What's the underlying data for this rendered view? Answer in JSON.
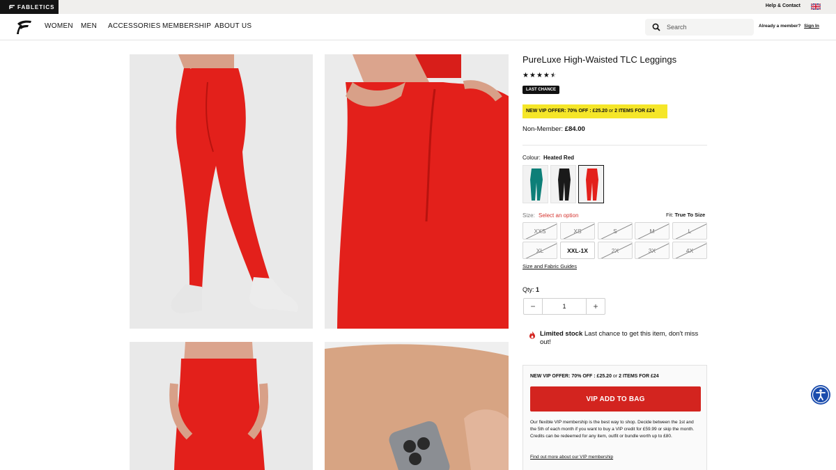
{
  "topbar": {
    "brand": "FABLETICS",
    "help": "Help & Contact"
  },
  "nav": {
    "items": [
      "WOMEN",
      "MEN",
      "ACCESSORIES",
      "MEMBERSHIP",
      "ABOUT US"
    ],
    "search_placeholder": "Search",
    "member_prompt": "Already a member?",
    "sign_in": "Sign In"
  },
  "product": {
    "title": "PureLuxe High-Waisted TLC Leggings",
    "rating": 4.5,
    "badge": "LAST CHANCE",
    "vip_offer": {
      "prefix": "NEW VIP OFFER: 70% OFF : £25.20",
      "or": "or",
      "suffix": "2 ITEMS FOR £24"
    },
    "price_label": "Non-Member:",
    "price": "£84.00",
    "colour_label": "Colour:",
    "colour": "Heated Red",
    "swatches": [
      "teal",
      "black",
      "heated-red"
    ],
    "size_label": "Size:",
    "size_prompt": "Select an option",
    "fit_label": "Fit:",
    "fit": "True To Size",
    "sizes": [
      {
        "label": "XXS",
        "available": false
      },
      {
        "label": "XS",
        "available": false
      },
      {
        "label": "S",
        "available": false
      },
      {
        "label": "M",
        "available": false
      },
      {
        "label": "L",
        "available": false
      },
      {
        "label": "XL",
        "available": false
      },
      {
        "label": "XXL-1X",
        "available": true
      },
      {
        "label": "2X",
        "available": false
      },
      {
        "label": "3X",
        "available": false
      },
      {
        "label": "4X",
        "available": false
      }
    ],
    "guide_link": "Size and Fabric Guides",
    "qty_label": "Qty:",
    "qty": "1",
    "qty_minus": "−",
    "qty_plus": "+",
    "stock_title": "Limited stock",
    "stock_text": "Last chance to get this item, don't miss out!"
  },
  "vip_box": {
    "offer_prefix": "NEW VIP OFFER: 70% OFF : £25.20",
    "offer_or": "or",
    "offer_suffix": "2 ITEMS FOR £24",
    "button": "VIP ADD TO BAG",
    "description": "Our flexible VIP membership is the best way to shop. Decide between the 1st and the 5th of each month if you want to buy a VIP credit for £59.99 or skip the month. Credits can be redeemed for any item, outfit or bundle worth up to £80.",
    "more_link": "Find out more about our VIP membership"
  },
  "colors": {
    "accent_red": "#d3241f",
    "legging_red": "#e3201b",
    "vip_yellow": "#f5e629",
    "accessibility_blue": "#1a4cad"
  }
}
